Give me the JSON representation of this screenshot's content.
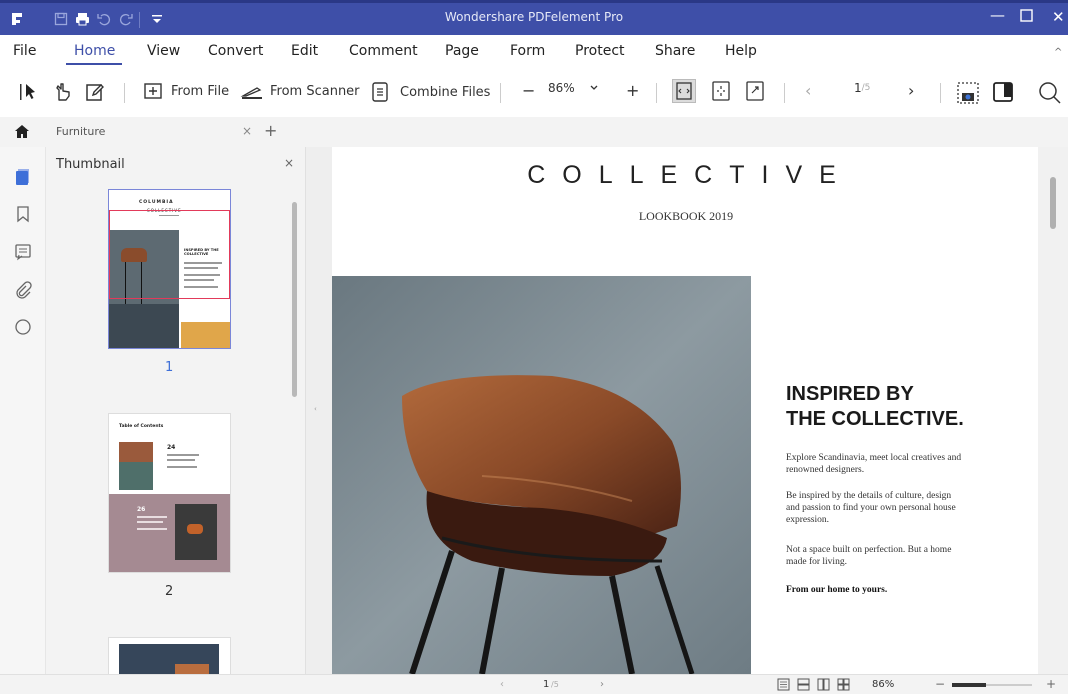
{
  "window": {
    "title": "Wondershare PDFelement Pro",
    "accent": "#3e4fa8"
  },
  "menu": {
    "items": [
      "File",
      "Home",
      "View",
      "Convert",
      "Edit",
      "Comment",
      "Page",
      "Form",
      "Protect",
      "Share",
      "Help"
    ],
    "active": "Home"
  },
  "toolbar": {
    "from_file": "From File",
    "from_scanner": "From Scanner",
    "combine_files": "Combine Files",
    "zoom_minus": "−",
    "zoom_value": "86%",
    "zoom_plus": "+",
    "page_prev": "‹",
    "page_current": "1",
    "page_total": "/5",
    "page_next": "›"
  },
  "tabs": {
    "doc_name": "Furniture",
    "close": "×",
    "add": "+"
  },
  "thumbnail_panel": {
    "title": "Thumbnail",
    "close": "×",
    "pages": [
      {
        "number": "1",
        "selected": true
      },
      {
        "number": "2",
        "selected": false
      }
    ]
  },
  "thumbs": {
    "p1_title1": "COLUMBIA",
    "p1_title2": "COLLECTIVE",
    "p1_heading": "INSPIRED BY THE COLLECTIVE",
    "p2_title": "Table of Contents",
    "p2_n1": "24",
    "p2_n2": "26"
  },
  "document": {
    "title": "COLLECTIVE",
    "subtitle": "LOOKBOOK 2019",
    "heading_line1": "INSPIRED BY",
    "heading_line2": "THE COLLECTIVE.",
    "para1": "Explore Scandinavia, meet local creatives and renowned designers.",
    "para2": "Be inspired by the details of culture, design and passion to find your own personal house expression.",
    "para3": "Not a space built on perfection. But a home made for living.",
    "para4": "From our home to yours."
  },
  "statusbar": {
    "page_current": "1",
    "page_total": "/5",
    "zoom": "86%",
    "minus": "−",
    "plus": "+"
  }
}
